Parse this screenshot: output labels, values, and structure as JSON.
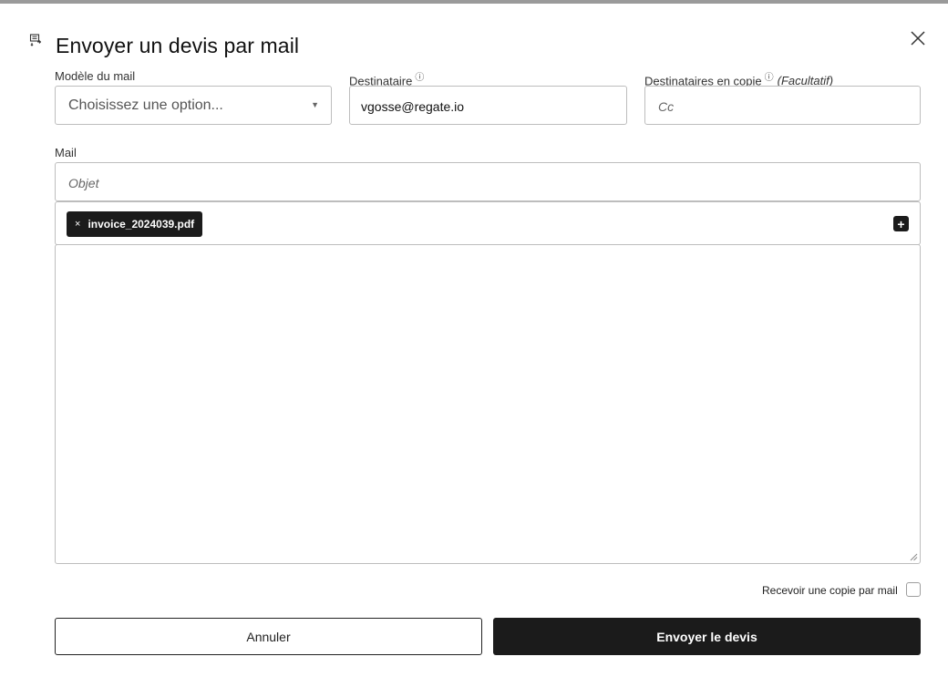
{
  "dialog": {
    "title": "Envoyer un devis par mail"
  },
  "fields": {
    "template_label": "Modèle du mail",
    "template_value": "Choisissez une option...",
    "recipient_label": "Destinataire",
    "recipient_value": "vgosse@regate.io",
    "cc_label": "Destinataires en copie",
    "cc_optional": "(Facultatif)",
    "cc_placeholder": "Cc",
    "info_glyph": "ⓘ",
    "mail_label": "Mail",
    "subject_placeholder": "Objet",
    "body_value": ""
  },
  "attachments": [
    {
      "name": "invoice_2024039.pdf",
      "remove": "×"
    }
  ],
  "options": {
    "receive_copy_label": "Recevoir une copie par mail",
    "receive_copy_checked": false
  },
  "actions": {
    "cancel": "Annuler",
    "send": "Envoyer le devis"
  },
  "icons": {
    "title": "document-send-icon",
    "close": "close-icon",
    "add": "plus-icon",
    "select": "chevron-down-icon"
  },
  "colors": {
    "primary": "#1b1b1b",
    "border": "#bdbdbd"
  }
}
